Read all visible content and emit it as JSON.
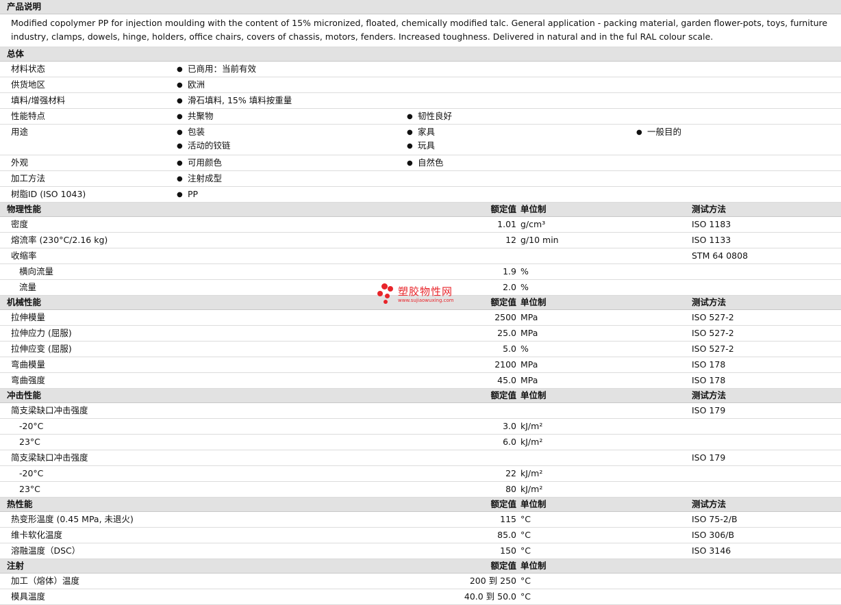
{
  "desc": {
    "title": "产品说明",
    "text": "Modified copolymer PP for injection moulding with the content of 15% micronized, floated, chemically modified talc. General application - packing material, garden flower-pots, toys, furniture industry, clamps, dowels, hinge, holders, office chairs, covers of chassis, motors, fenders. Increased toughness. Delivered in natural and in the ful RAL colour scale."
  },
  "general": {
    "title": "总体",
    "rows": [
      {
        "label": "材料状态",
        "items": [
          "已商用：当前有效"
        ]
      },
      {
        "label": "供货地区",
        "items": [
          "欧洲"
        ]
      },
      {
        "label": "填料/增强材料",
        "items": [
          "滑石填料, 15% 填料按重量"
        ]
      },
      {
        "label": "性能特点",
        "items": [
          "共聚物",
          "韧性良好"
        ]
      },
      {
        "label": "用途",
        "items": [
          "包装",
          "家具",
          "一般目的",
          "活动的铰链",
          "玩具"
        ]
      },
      {
        "label": "外观",
        "items": [
          "可用颜色",
          "自然色"
        ]
      },
      {
        "label": "加工方法",
        "items": [
          "注射成型"
        ]
      },
      {
        "label": "树脂ID (ISO 1043)",
        "items": [
          "PP"
        ]
      }
    ]
  },
  "headers": {
    "value": "额定值",
    "unit": "单位制",
    "method": "测试方法"
  },
  "physical": {
    "title": "物理性能",
    "rows": [
      {
        "label": "密度",
        "value": "1.01",
        "unit": "g/cm³",
        "method": "ISO 1183"
      },
      {
        "label": "熔流率  (230°C/2.16 kg)",
        "value": "12",
        "unit": "g/10 min",
        "method": "ISO 1133"
      },
      {
        "label": "收缩率",
        "value": "",
        "unit": "",
        "method": "STM 64 0808"
      },
      {
        "label": "横向流量",
        "value": "1.9",
        "unit": "%",
        "method": ""
      },
      {
        "label": "流量",
        "value": "2.0",
        "unit": "%",
        "method": ""
      }
    ]
  },
  "mechanical": {
    "title": "机械性能",
    "rows": [
      {
        "label": "拉伸模量",
        "value": "2500",
        "unit": "MPa",
        "method": "ISO 527-2"
      },
      {
        "label": "拉伸应力  (屈服)",
        "value": "25.0",
        "unit": "MPa",
        "method": "ISO 527-2"
      },
      {
        "label": "拉伸应变  (屈服)",
        "value": "5.0",
        "unit": "%",
        "method": "ISO 527-2"
      },
      {
        "label": "弯曲模量",
        "value": "2100",
        "unit": "MPa",
        "method": "ISO 178"
      },
      {
        "label": "弯曲强度",
        "value": "45.0",
        "unit": "MPa",
        "method": "ISO 178"
      }
    ]
  },
  "impact": {
    "title": "冲击性能",
    "rows": [
      {
        "label": "简支梁缺口冲击强度",
        "value": "",
        "unit": "",
        "method": "ISO 179"
      },
      {
        "label": "-20°C",
        "value": "3.0",
        "unit": "kJ/m²",
        "method": ""
      },
      {
        "label": "23°C",
        "value": "6.0",
        "unit": "kJ/m²",
        "method": ""
      },
      {
        "label": "简支梁缺口冲击强度",
        "value": "",
        "unit": "",
        "method": "ISO 179"
      },
      {
        "label": "-20°C",
        "value": "22",
        "unit": "kJ/m²",
        "method": ""
      },
      {
        "label": "23°C",
        "value": "80",
        "unit": "kJ/m²",
        "method": ""
      }
    ]
  },
  "thermal": {
    "title": "热性能",
    "rows": [
      {
        "label": "热变形温度  (0.45 MPa, 未退火)",
        "value": "115",
        "unit": "°C",
        "method": "ISO 75-2/B"
      },
      {
        "label": "维卡软化温度",
        "value": "85.0",
        "unit": "°C",
        "method": "ISO 306/B"
      },
      {
        "label": "溶融温度（DSC）",
        "value": "150",
        "unit": "°C",
        "method": "ISO 3146"
      }
    ]
  },
  "injection": {
    "title": "注射",
    "rows": [
      {
        "label": "加工（熔体）温度",
        "value": "200 到  250",
        "unit": "°C",
        "method": ""
      },
      {
        "label": "模具温度",
        "value": "40.0 到  50.0",
        "unit": "°C",
        "method": ""
      }
    ]
  },
  "watermark": {
    "title": "塑胶物性网",
    "url": "www.sujiaowuxing.com"
  },
  "colors": {
    "accent": "#e8242a",
    "header_bg": "#e2e2e2"
  }
}
